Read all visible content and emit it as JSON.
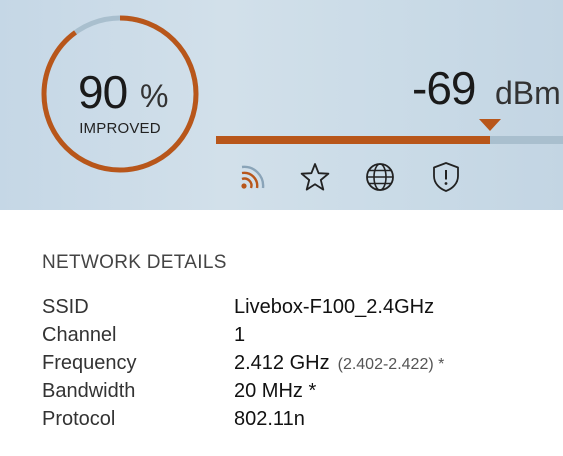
{
  "header": {
    "improvement": {
      "value": "90",
      "unit": "%",
      "label": "IMPROVED",
      "fraction": 0.9
    },
    "signal": {
      "value": "-69",
      "unit": "dBm",
      "level_fraction": 0.79
    },
    "icons": [
      {
        "name": "wifi-signal-icon"
      },
      {
        "name": "star-icon"
      },
      {
        "name": "globe-icon"
      },
      {
        "name": "shield-alert-icon"
      }
    ]
  },
  "details": {
    "title": "NETWORK DETAILS",
    "rows": [
      {
        "label": "SSID",
        "value": "Livebox-F100_2.4GHz",
        "extra": ""
      },
      {
        "label": "Channel",
        "value": "1",
        "extra": ""
      },
      {
        "label": "Frequency",
        "value": "2.412 GHz",
        "extra": "(2.402-2.422) *"
      },
      {
        "label": "Bandwidth",
        "value": "20 MHz *",
        "extra": ""
      },
      {
        "label": "Protocol",
        "value": "802.11n",
        "extra": ""
      }
    ]
  },
  "colors": {
    "accent": "#b8561a",
    "gauge_track": "#a9bfce",
    "header_bg": "#c9dbe8"
  }
}
